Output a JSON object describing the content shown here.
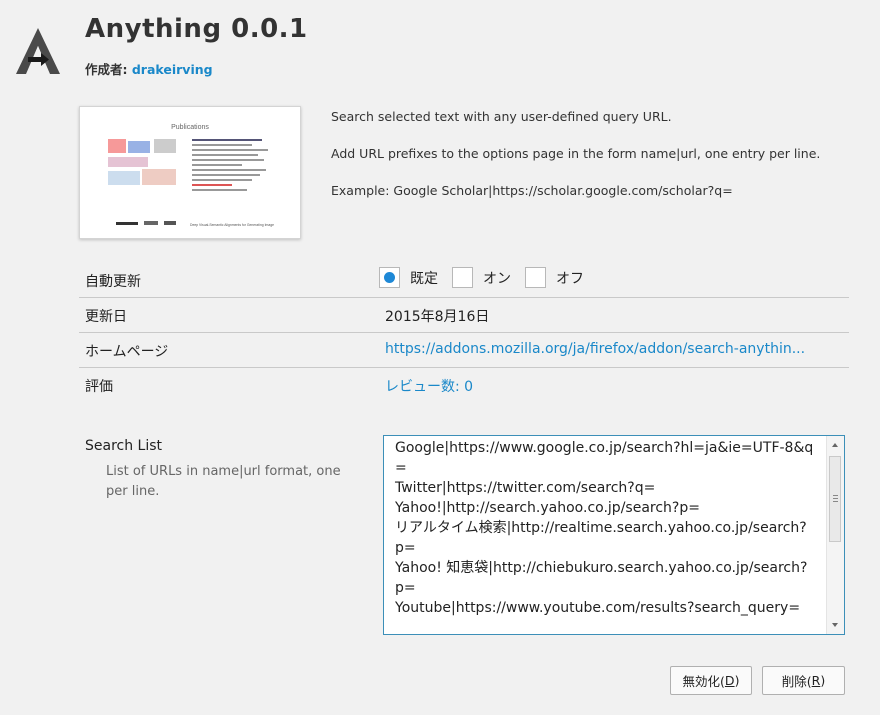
{
  "header": {
    "title": "Anything 0.0.1",
    "author_label": "作成者:",
    "author_name": "drakeirving"
  },
  "thumbnail": {
    "title": "Publications",
    "caption": "Deep Visual-Semantic Alignments for Generating Image"
  },
  "description": {
    "line1": "Search selected text with any user-defined query URL.",
    "line2": "Add URL prefixes to the options page in the form name|url, one entry per line.",
    "line3": "Example: Google Scholar|https://scholar.google.com/scholar?q="
  },
  "details": {
    "auto_update": {
      "label": "自動更新",
      "options": [
        {
          "label": "既定",
          "selected": true
        },
        {
          "label": "オン",
          "selected": false
        },
        {
          "label": "オフ",
          "selected": false
        }
      ]
    },
    "updated": {
      "label": "更新日",
      "value": "2015年8月16日"
    },
    "homepage": {
      "label": "ホームページ",
      "value": "https://addons.mozilla.org/ja/firefox/addon/search-anythin..."
    },
    "rating": {
      "label": "評価",
      "value": "レビュー数: 0"
    }
  },
  "search_list": {
    "title": "Search List",
    "description": "List of URLs in name|url format, one per line.",
    "value": "Google|https://www.google.co.jp/search?hl=ja&ie=UTF-8&q=\nTwitter|https://twitter.com/search?q=\nYahoo!|http://search.yahoo.co.jp/search?p=\nリアルタイム検索|http://realtime.search.yahoo.co.jp/search?p=\nYahoo! 知恵袋|http://chiebukuro.search.yahoo.co.jp/search?p=\nYoutube|https://www.youtube.com/results?search_query="
  },
  "buttons": {
    "disable": {
      "label": "無効化(",
      "key": "D",
      "suffix": ")"
    },
    "remove": {
      "label": "削除(",
      "key": "R",
      "suffix": ")"
    }
  },
  "colors": {
    "link": "#1a88c9",
    "accent": "#1e88d6",
    "focus_border": "#3c8fb8"
  }
}
